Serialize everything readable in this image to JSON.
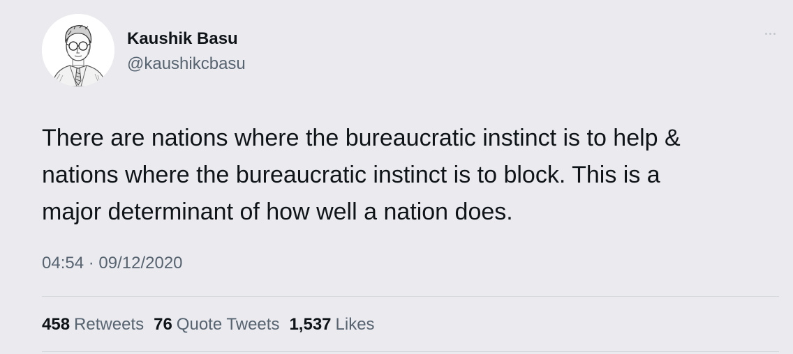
{
  "tweet": {
    "author_name": "Kaushik Basu",
    "author_handle": "@kaushikcbasu",
    "text_lines": [
      "There are nations where the bureaucratic instinct is to help &",
      "nations where the bureaucratic instinct is to block. This is a",
      "major determinant of how well a nation does."
    ],
    "time": "04:54",
    "separator": "·",
    "date": "09/12/2020",
    "more_icon": "more-dots-icon",
    "stats": {
      "retweets_count": "458",
      "retweets_label": "Retweets",
      "quote_tweets_count": "76",
      "quote_tweets_label": "Quote Tweets",
      "likes_count": "1,537",
      "likes_label": "Likes"
    }
  },
  "colors": {
    "background": "#ebebef",
    "primary_text": "#0f1419",
    "secondary_text": "#566370",
    "divider": "#d6d9dd"
  }
}
